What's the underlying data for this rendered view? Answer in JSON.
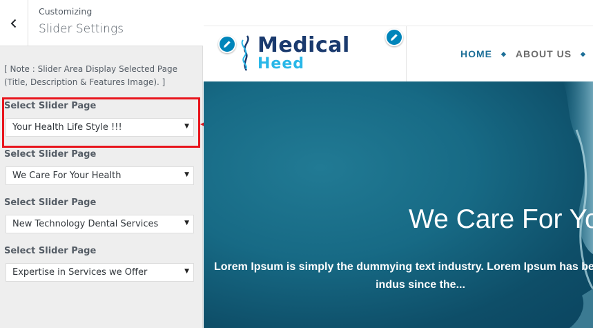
{
  "sidebar": {
    "breadcrumb": "Customizing",
    "title": "Slider Settings",
    "note": "[ Note : Slider Area Display Selected Page (Title, Description & Features Image). ]",
    "fields": [
      {
        "label": "Select Slider Page",
        "value": "Your Health Life Style !!!"
      },
      {
        "label": "Select Slider Page",
        "value": "We Care For Your Health"
      },
      {
        "label": "Select Slider Page",
        "value": "New Technology Dental Services"
      },
      {
        "label": "Select Slider Page",
        "value": "Expertise in Services we Offer"
      }
    ]
  },
  "preview": {
    "logo": {
      "name": "Medical",
      "sub": "Heed"
    },
    "nav": [
      {
        "label": "HOME",
        "color": "#1d6f98"
      },
      {
        "label": "ABOUT US",
        "color": "#6b6b6b"
      }
    ],
    "hero": {
      "title": "We Care For Yo",
      "description": "Lorem Ipsum is simply the dummying text industry. Lorem Ipsum has been the indus since the..."
    }
  },
  "colors": {
    "accent": "#0085ba",
    "highlight": "#e8141c",
    "hero_bg": "#176a85"
  }
}
